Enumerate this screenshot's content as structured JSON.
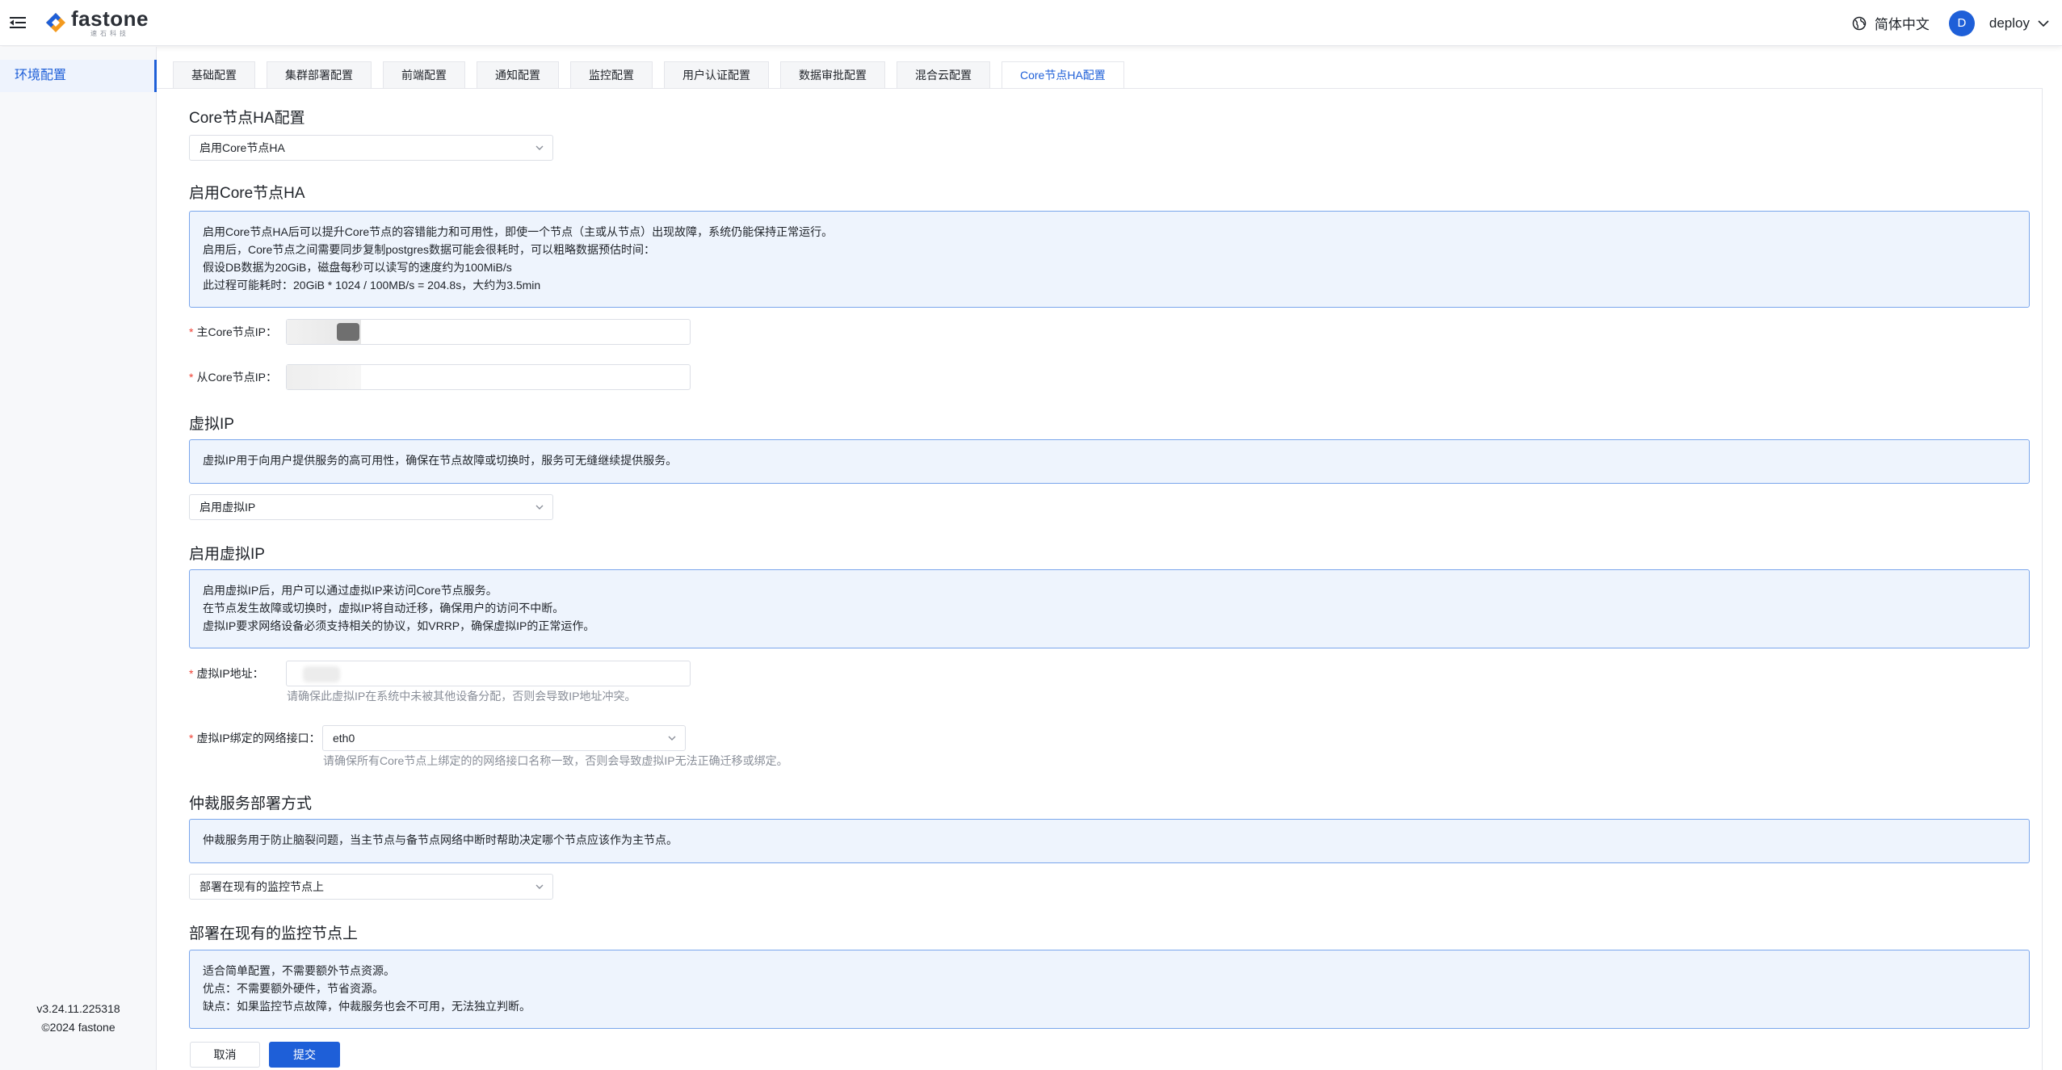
{
  "header": {
    "logo_text": "fastone",
    "logo_sub": "速石科技",
    "language": "简体中文",
    "avatar_letter": "D",
    "username": "deploy"
  },
  "sidebar": {
    "items": [
      {
        "label": "环境配置",
        "active": true
      }
    ],
    "version": "v3.24.11.225318",
    "copyright": "©2024 fastone"
  },
  "tabs": [
    {
      "label": "基础配置"
    },
    {
      "label": "集群部署配置"
    },
    {
      "label": "前端配置"
    },
    {
      "label": "通知配置"
    },
    {
      "label": "监控配置"
    },
    {
      "label": "用户认证配置"
    },
    {
      "label": "数据审批配置"
    },
    {
      "label": "混合云配置"
    },
    {
      "label": "Core节点HA配置",
      "active": true
    }
  ],
  "core_ha": {
    "title": "Core节点HA配置",
    "select_value": "启用Core节点HA",
    "enabled_title": "启用Core节点HA",
    "info_lines": [
      "启用Core节点HA后可以提升Core节点的容错能力和可用性，即使一个节点（主或从节点）出现故障，系统仍能保持正常运行。",
      "启用后，Core节点之间需要同步复制postgres数据可能会很耗时，可以粗略数据预估时间：",
      "假设DB数据为20GiB，磁盘每秒可以读写的速度约为100MiB/s",
      "此过程可能耗时：20GiB * 1024 / 100MB/s = 204.8s，大约为3.5min"
    ],
    "primary_ip_label": "主Core节点IP：",
    "secondary_ip_label": "从Core节点IP："
  },
  "virtual_ip": {
    "title": "虚拟IP",
    "info": "虚拟IP用于向用户提供服务的高可用性，确保在节点故障或切换时，服务可无缝继续提供服务。",
    "select_value": "启用虚拟IP",
    "enabled_title": "启用虚拟IP",
    "info_lines": [
      "启用虚拟IP后，用户可以通过虚拟IP来访问Core节点服务。",
      "在节点发生故障或切换时，虚拟IP将自动迁移，确保用户的访问不中断。",
      "虚拟IP要求网络设备必须支持相关的协议，如VRRP，确保虚拟IP的正常运作。"
    ],
    "address_label": "虚拟IP地址：",
    "address_hint": "请确保此虚拟IP在系统中未被其他设备分配，否则会导致IP地址冲突。",
    "interface_label": "虚拟IP绑定的网络接口：",
    "interface_value": "eth0",
    "interface_hint": "请确保所有Core节点上绑定的的网络接口名称一致，否则会导致虚拟IP无法正确迁移或绑定。"
  },
  "arbiter": {
    "title": "仲裁服务部署方式",
    "info": "仲裁服务用于防止脑裂问题，当主节点与备节点网络中断时帮助决定哪个节点应该作为主节点。",
    "select_value": "部署在现有的监控节点上",
    "mode_title": "部署在现有的监控节点上",
    "info_lines": [
      "适合简单配置，不需要额外节点资源。",
      "优点：不需要额外硬件，节省资源。",
      "缺点：如果监控节点故障，仲裁服务也会不可用，无法独立判断。"
    ]
  },
  "actions": {
    "cancel": "取消",
    "submit": "提交"
  },
  "colors": {
    "primary": "#1e5fd8",
    "info_bg": "#eef4fd",
    "info_border": "#7aa6ec",
    "required": "#f04134"
  }
}
